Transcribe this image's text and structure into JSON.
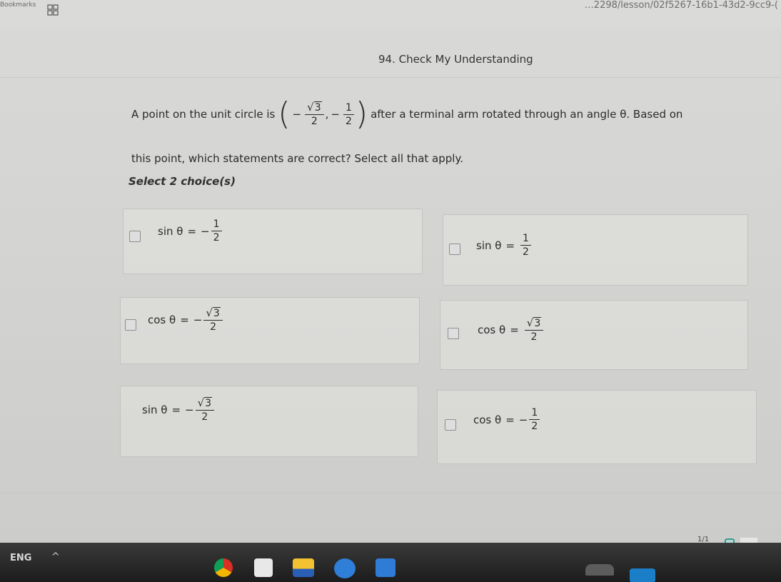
{
  "topbar": {
    "bookmarks_label": "Bookmarks",
    "url_fragment": "…2298/lesson/02f5267-16b1-43d2-9cc9-("
  },
  "section": {
    "title": "94. Check My Understanding"
  },
  "question": {
    "text_start": "A point on the unit circle is",
    "point_x_num": "3",
    "point_x_den": "2",
    "point_y_num": "1",
    "point_y_den": "2",
    "text_end": "after a terminal arm rotated through an angle θ. Based on",
    "line2": "this point, which statements are correct? Select all that apply."
  },
  "select_label": "Select 2 choice(s)",
  "choices": [
    {
      "lhs": "sin θ",
      "sign": "−",
      "num": "1",
      "sqrt": false,
      "den": "2"
    },
    {
      "lhs": "sin θ",
      "sign": "",
      "num": "1",
      "sqrt": false,
      "den": "2"
    },
    {
      "lhs": "cos θ",
      "sign": "−",
      "num": "3",
      "sqrt": true,
      "den": "2"
    },
    {
      "lhs": "cos θ",
      "sign": "",
      "num": "3",
      "sqrt": true,
      "den": "2"
    },
    {
      "lhs": "sin θ",
      "sign": "−",
      "num": "3",
      "sqrt": true,
      "den": "2"
    },
    {
      "lhs": "cos θ",
      "sign": "−",
      "num": "1",
      "sqrt": false,
      "den": "2"
    }
  ],
  "pager": {
    "text": "1/1"
  },
  "taskbar": {
    "language": "ENG"
  },
  "colors": {
    "accent": "#3a9a90",
    "taskbar": "#1c1c1c"
  }
}
